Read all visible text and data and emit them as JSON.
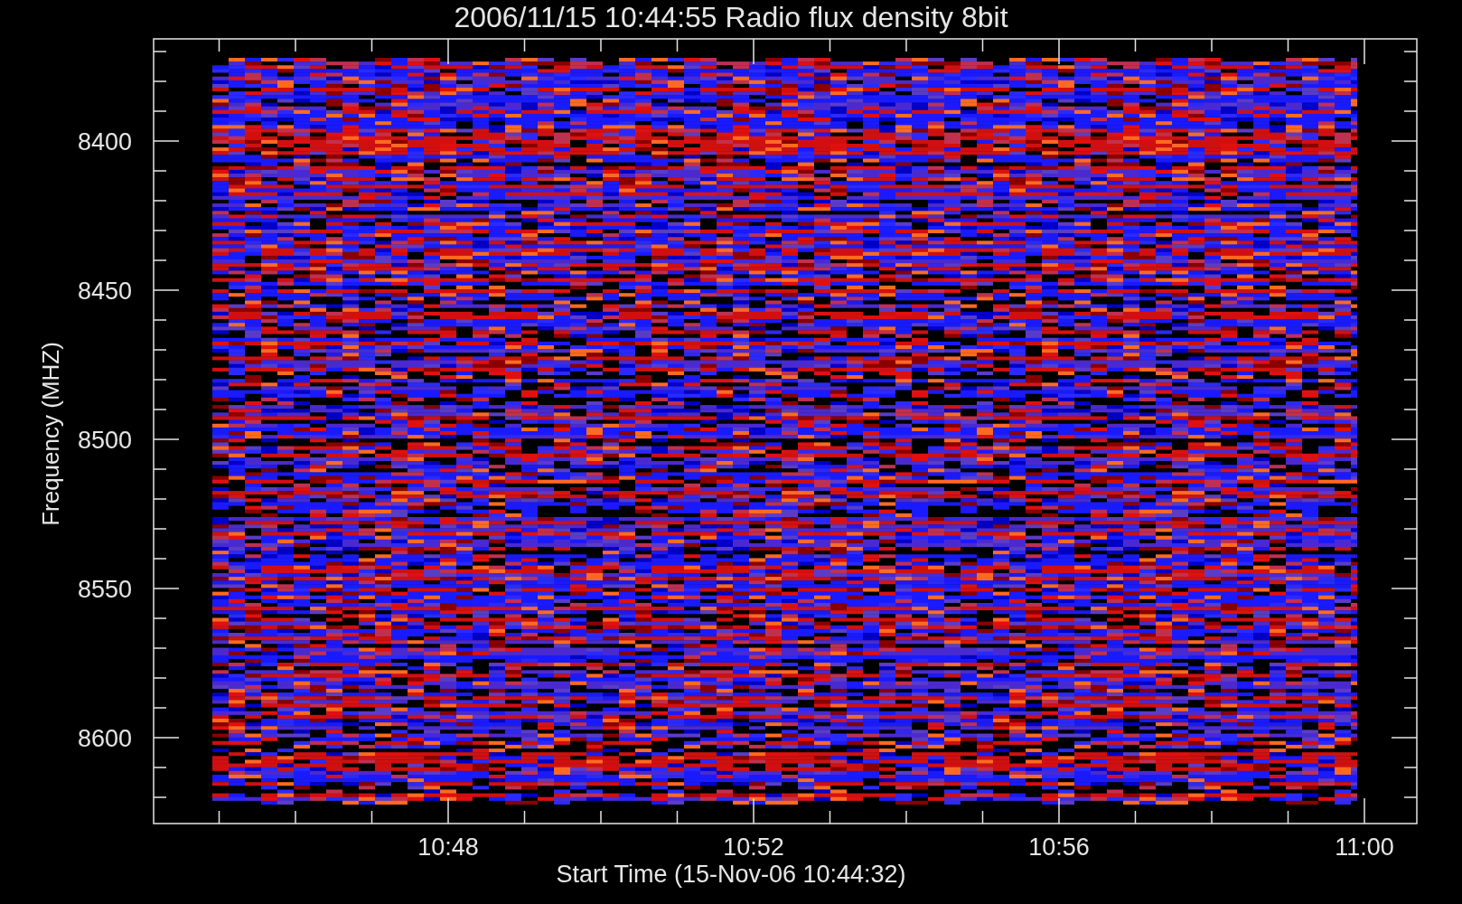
{
  "title": "2006/11/15 10:44:55 Radio flux density 8bit",
  "y_axis": {
    "label": "Frequency (MHZ)",
    "ticks": [
      "8400",
      "8450",
      "8500",
      "8550",
      "8600"
    ]
  },
  "x_axis": {
    "label": "Start Time (15-Nov-06 10:44:32)",
    "ticks": [
      "10:48",
      "10:52",
      "10:56",
      "11:00"
    ]
  }
}
